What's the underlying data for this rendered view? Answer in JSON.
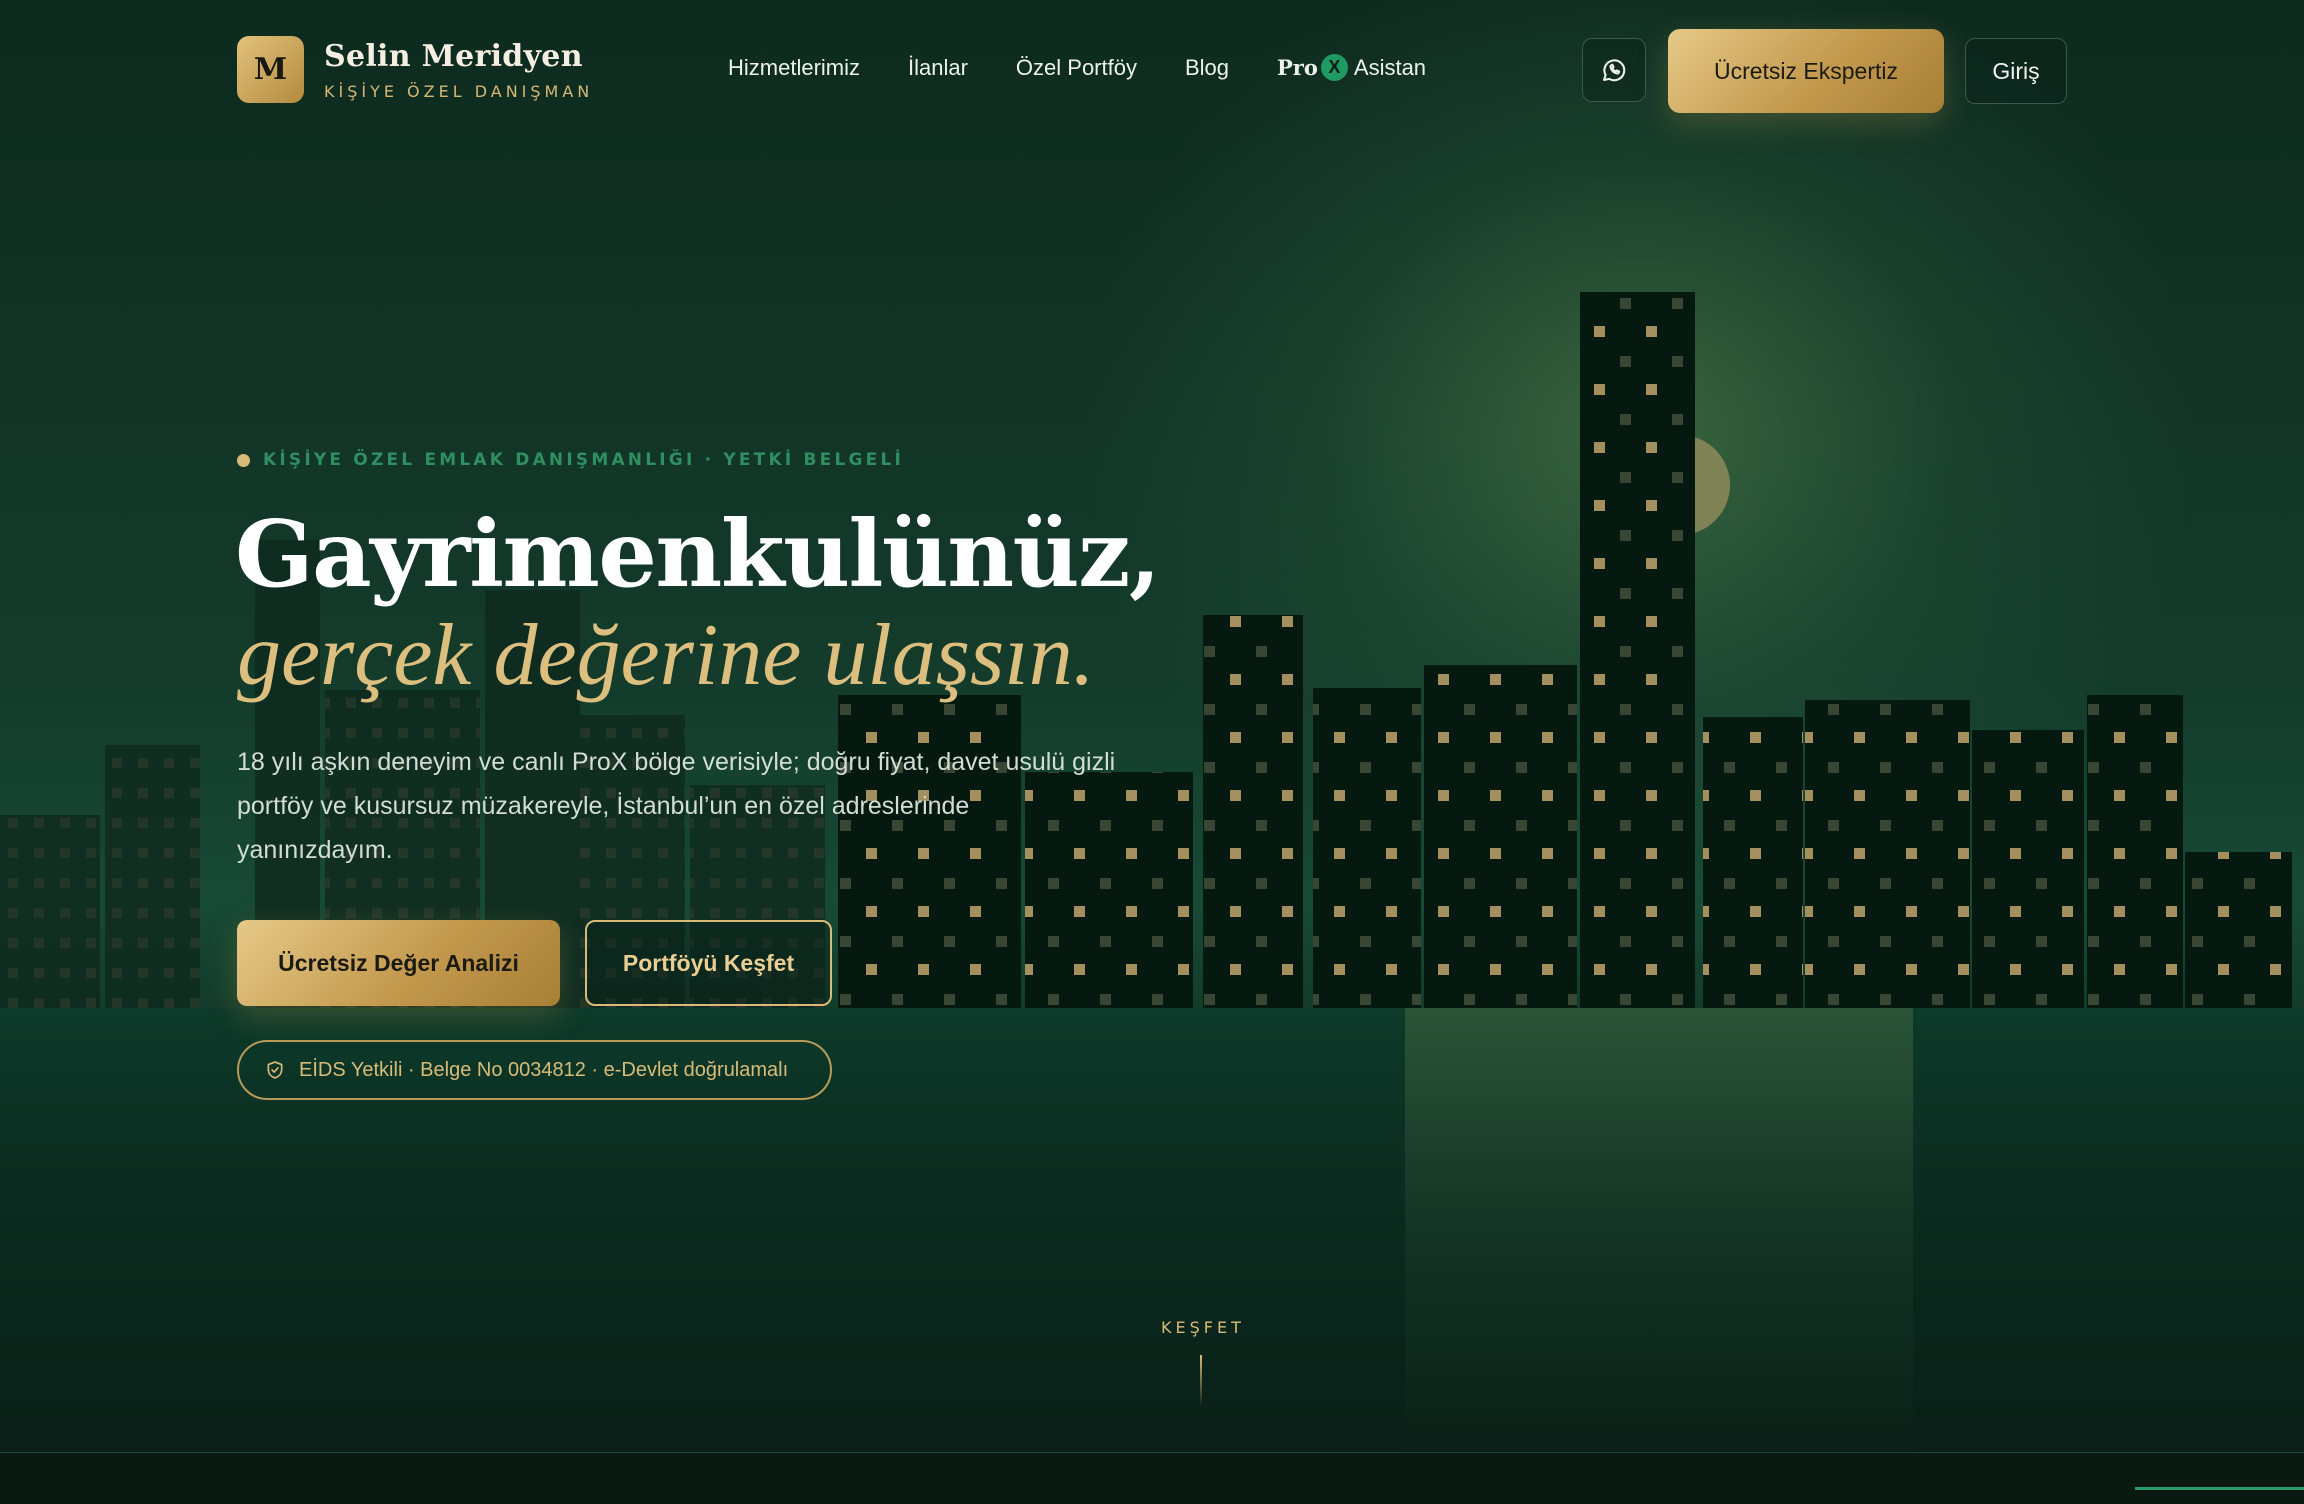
{
  "brand": {
    "mark": "M",
    "name": "Selin Meridyen",
    "subtitle": "KİŞİYE ÖZEL DANIŞMAN"
  },
  "nav": {
    "items": [
      "Hizmetlerimiz",
      "İlanlar",
      "Özel Portföy",
      "Blog"
    ],
    "prox": {
      "pro": "Pro",
      "x": "X",
      "label": "Asistan"
    }
  },
  "header": {
    "whatsapp_icon": "whatsapp-icon",
    "cta": "Ücretsiz Ekspertiz",
    "login": "Giriş"
  },
  "hero": {
    "eyebrow": "KİŞİYE ÖZEL EMLAK DANIŞMANLIĞI · YETKİ BELGELİ",
    "title_line1": "Gayrimenkulünüz,",
    "title_line2": "gerçek değerine ulaşsın.",
    "lead": "18 yılı aşkın deneyim ve canlı ProX bölge verisiyle; doğru fiyat, davet usulü gizli portföy ve kusursuz müzakereyle, İstanbul’un en özel adreslerinde yanınızdayım.",
    "primary_button": "Ücretsiz Değer Analizi",
    "secondary_button": "Portföyü Keşfet",
    "badge": "EİDS Yetkili · Belge No 0034812 · e-Devlet doğrulamalı",
    "badge_icon": "shield-check-icon"
  },
  "explore": {
    "label": "KEŞFET"
  },
  "colors": {
    "gold": "#d9bb79",
    "gold_dark": "#a77f35",
    "green_accent": "#2f8f62",
    "bg_dark": "#0a1a13"
  }
}
